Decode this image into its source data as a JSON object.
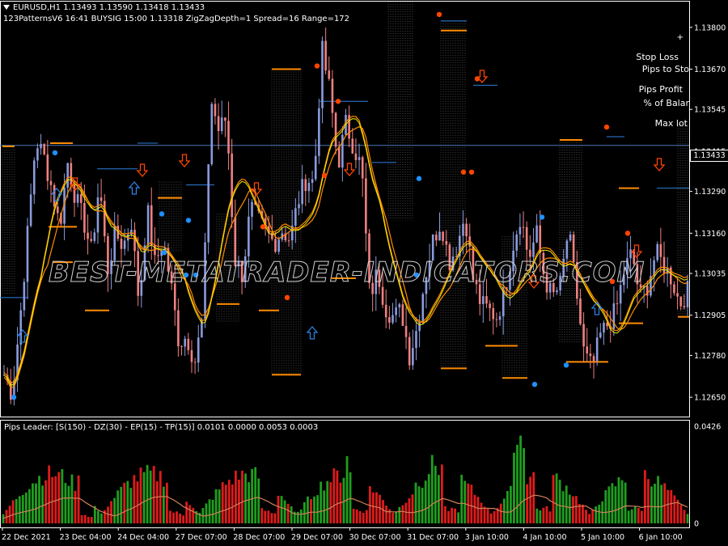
{
  "header": {
    "line1": "EURUSD,H1  1.13493 1.13590 1.13418 1.13433",
    "line2": "123PatternsV6  16:41  BUYSIG  15:00  1.13318  ZigZagDepth=1  Spread=16  Range=172"
  },
  "right_panel": {
    "stop_loss": "Stop Loss",
    "pips_to_stop": "Pips to Sto",
    "pips_profit": "Pips Profit",
    "pct_balance": "% of Balar",
    "max_lot": "Max lot",
    "plus": "+"
  },
  "watermark": "BEST-METATRADER-INDICATORS.COM",
  "indicator_title": "Pips Leader: [S(150) - DZ(30) - EP(15) - TP(15)] 0.0101 0.0000 0.0053 0.0003",
  "current_price_label": "1.13433",
  "colors": {
    "background": "#000000",
    "bull_bar": "#8a9bdc",
    "bear_bar": "#f08080",
    "hist_green": "#1f9e1f",
    "hist_red": "#e01b1b",
    "ma_outer": "#ff8c00",
    "ma_inner": "#f0f000",
    "level_orange": "#ff8c00",
    "level_blue": "#2e7fe0",
    "dot_blue": "#1e90ff",
    "dot_red": "#ff4500"
  },
  "chart_data": [
    {
      "type": "candlestick",
      "symbol": "EURUSD",
      "timeframe": "H1",
      "y_ticks": [
        "1.13800",
        "1.13670",
        "1.13545",
        "1.13415",
        "1.13290",
        "1.13160",
        "1.13035",
        "1.12905",
        "1.12780",
        "1.12650"
      ],
      "ylim": [
        1.1259,
        1.1388
      ],
      "x_ticks": [
        "22 Dec 2021",
        "23 Dec 04:00",
        "24 Dec 04:00",
        "27 Dec 07:00",
        "28 Dec 07:00",
        "29 Dec 07:00",
        "30 Dec 07:00",
        "31 Dec 07:00",
        "3 Jan 10:00",
        "4 Jan 10:00",
        "5 Jan 10:00",
        "6 Jan 10:00"
      ],
      "close_path": [
        1.1272,
        1.1266,
        1.1289,
        1.1317,
        1.1345,
        1.134,
        1.133,
        1.1318,
        1.1338,
        1.1327,
        1.132,
        1.131,
        1.1332,
        1.1304,
        1.1316,
        1.1312,
        1.132,
        1.1294,
        1.1324,
        1.1306,
        1.1314,
        1.13,
        1.1282,
        1.1284,
        1.1276,
        1.129,
        1.1358,
        1.1348,
        1.1352,
        1.1308,
        1.1303,
        1.1324,
        1.132,
        1.1316,
        1.1313,
        1.1317,
        1.1314,
        1.1326,
        1.1333,
        1.1332,
        1.1373,
        1.136,
        1.1337,
        1.135,
        1.1343,
        1.1336,
        1.1296,
        1.1304,
        1.1293,
        1.129,
        1.1292,
        1.1278,
        1.1287,
        1.1303,
        1.1314,
        1.132,
        1.1307,
        1.1312,
        1.1322,
        1.1302,
        1.1294,
        1.1292,
        1.129,
        1.1298,
        1.1312,
        1.1322,
        1.1308,
        1.1316,
        1.1302,
        1.1296,
        1.13,
        1.1317,
        1.1298,
        1.1278,
        1.1274,
        1.1284,
        1.1288,
        1.1292,
        1.1304,
        1.131,
        1.1296,
        1.13,
        1.131,
        1.1306,
        1.1302,
        1.1294,
        1.1298
      ]
    },
    {
      "type": "bar",
      "name": "Pips Leader",
      "ylim": [
        0,
        0.0426
      ],
      "y_ticks": [
        "0.0426",
        "0"
      ]
    }
  ]
}
